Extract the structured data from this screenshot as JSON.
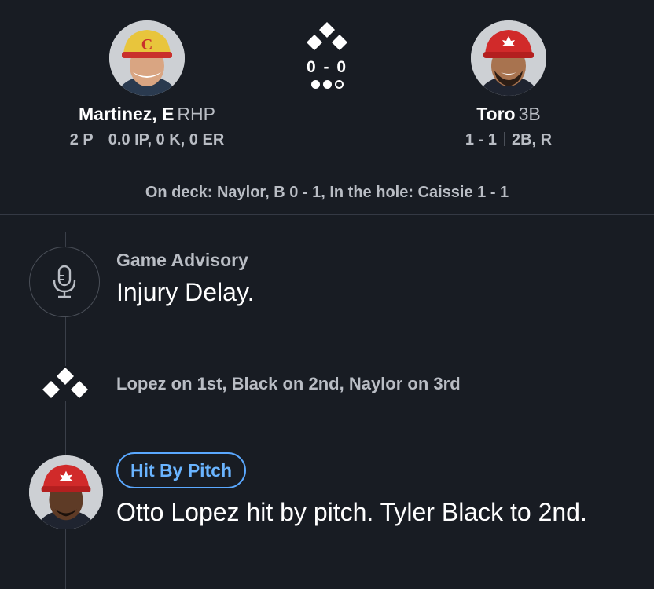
{
  "matchup": {
    "pitcher": {
      "name": "Martinez, E",
      "position": "RHP",
      "pitches": "2 P",
      "line": "0.0 IP, 0 K, 0 ER",
      "cap_letter": "C"
    },
    "count": "0 - 0",
    "outs": [
      true,
      true,
      false
    ],
    "bases": {
      "first": false,
      "second": false,
      "third": false
    },
    "batter": {
      "name": "Toro",
      "position": "3B",
      "record": "1 - 1",
      "line": "2B, R"
    }
  },
  "on_deck": "On deck: Naylor, B 0 - 1, In the hole: Caissie 1 - 1",
  "feed": {
    "advisory": {
      "title": "Game Advisory",
      "text": "Injury Delay.",
      "icon": "microphone-icon"
    },
    "runners": {
      "text": "Lopez on 1st, Black on 2nd, Naylor on 3rd",
      "icon": "bases-icon"
    },
    "play": {
      "badge": "Hit By Pitch",
      "text": "Otto Lopez hit by pitch. Tyler Black to 2nd."
    }
  },
  "colors": {
    "background": "#181c23",
    "muted_text": "#b9bdc4",
    "badge_blue": "#5aa8ff"
  }
}
